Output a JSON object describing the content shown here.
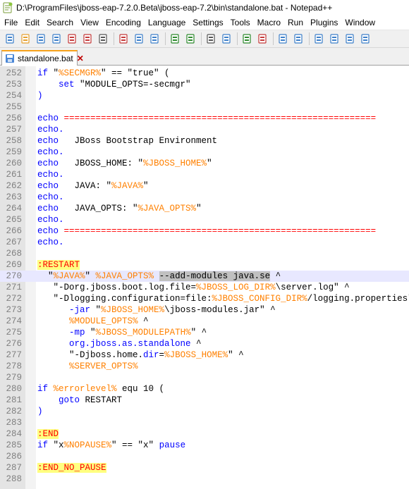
{
  "window": {
    "title": "D:\\ProgramFiles\\jboss-eap-7.2.0.Beta\\jboss-eap-7.2\\bin\\standalone.bat - Notepad++"
  },
  "menu": [
    "File",
    "Edit",
    "Search",
    "View",
    "Encoding",
    "Language",
    "Settings",
    "Tools",
    "Macro",
    "Run",
    "Plugins",
    "Window"
  ],
  "toolbar_icons": [
    "new-icon",
    "open-icon",
    "save-icon",
    "save-all-icon",
    "close-icon",
    "close-all-icon",
    "print-icon",
    "cut-icon",
    "copy-icon",
    "paste-icon",
    "undo-icon",
    "redo-icon",
    "find-icon",
    "replace-icon",
    "zoom-in-icon",
    "zoom-out-icon",
    "sync-vertical-icon",
    "sync-horizontal-icon",
    "word-wrap-icon",
    "show-all-chars-icon",
    "indent-guide-icon",
    "doc-map-icon"
  ],
  "tab": {
    "label": "standalone.bat",
    "close": "✕"
  },
  "editor": {
    "current_line": 270,
    "lines": [
      {
        "n": "252",
        "tokens": [
          [
            "kw",
            "if"
          ],
          [
            "plain",
            " \""
          ],
          [
            "var",
            "%SECMGR%"
          ],
          [
            "plain",
            "\" == \"true\" ("
          ]
        ]
      },
      {
        "n": "253",
        "tokens": [
          [
            "plain",
            "    "
          ],
          [
            "kw",
            "set"
          ],
          [
            "plain",
            " \"MODULE_OPTS=-secmgr\""
          ]
        ]
      },
      {
        "n": "254",
        "tokens": [
          [
            "kw",
            ")"
          ]
        ]
      },
      {
        "n": "255",
        "tokens": []
      },
      {
        "n": "256",
        "tokens": [
          [
            "kw",
            "echo"
          ],
          [
            "plain",
            " "
          ],
          [
            "lbl2",
            "==========================================================="
          ]
        ]
      },
      {
        "n": "257",
        "tokens": [
          [
            "kw",
            "echo."
          ]
        ]
      },
      {
        "n": "258",
        "tokens": [
          [
            "kw",
            "echo"
          ],
          [
            "plain",
            "   JBoss Bootstrap Environment"
          ]
        ]
      },
      {
        "n": "259",
        "tokens": [
          [
            "kw",
            "echo."
          ]
        ]
      },
      {
        "n": "260",
        "tokens": [
          [
            "kw",
            "echo"
          ],
          [
            "plain",
            "   JBOSS_HOME: \""
          ],
          [
            "var",
            "%JBOSS_HOME%"
          ],
          [
            "plain",
            "\""
          ]
        ]
      },
      {
        "n": "261",
        "tokens": [
          [
            "kw",
            "echo."
          ]
        ]
      },
      {
        "n": "262",
        "tokens": [
          [
            "kw",
            "echo"
          ],
          [
            "plain",
            "   JAVA: \""
          ],
          [
            "var",
            "%JAVA%"
          ],
          [
            "plain",
            "\""
          ]
        ]
      },
      {
        "n": "263",
        "tokens": [
          [
            "kw",
            "echo."
          ]
        ]
      },
      {
        "n": "264",
        "tokens": [
          [
            "kw",
            "echo"
          ],
          [
            "plain",
            "   JAVA_OPTS: \""
          ],
          [
            "var",
            "%JAVA_OPTS%"
          ],
          [
            "plain",
            "\""
          ]
        ]
      },
      {
        "n": "265",
        "tokens": [
          [
            "kw",
            "echo."
          ]
        ]
      },
      {
        "n": "266",
        "tokens": [
          [
            "kw",
            "echo"
          ],
          [
            "plain",
            " "
          ],
          [
            "lbl2",
            "==========================================================="
          ]
        ]
      },
      {
        "n": "267",
        "tokens": [
          [
            "kw",
            "echo."
          ]
        ]
      },
      {
        "n": "268",
        "tokens": []
      },
      {
        "n": "269",
        "tokens": [
          [
            "lbl",
            ":RESTART"
          ]
        ]
      },
      {
        "n": "270",
        "tokens": [
          [
            "plain",
            "  \""
          ],
          [
            "var",
            "%JAVA%"
          ],
          [
            "plain",
            "\" "
          ],
          [
            "var",
            "%JAVA_OPTS%"
          ],
          [
            "plain",
            " "
          ],
          [
            "sel",
            "--add-modules java.se"
          ],
          [
            "plain",
            " ^"
          ]
        ]
      },
      {
        "n": "271",
        "tokens": [
          [
            "plain",
            "   \"-Dorg.jboss.boot.log.file="
          ],
          [
            "var",
            "%JBOSS_LOG_DIR%"
          ],
          [
            "plain",
            "\\server.log\" ^"
          ]
        ]
      },
      {
        "n": "272",
        "tokens": [
          [
            "plain",
            "   \"-Dlogging.configuration=file:"
          ],
          [
            "var",
            "%JBOSS_CONFIG_DIR%"
          ],
          [
            "plain",
            "/logging.properties\" ^"
          ]
        ]
      },
      {
        "n": "273",
        "tokens": [
          [
            "plain",
            "      "
          ],
          [
            "kw",
            "-jar"
          ],
          [
            "plain",
            " \""
          ],
          [
            "var",
            "%JBOSS_HOME%"
          ],
          [
            "plain",
            "\\jboss-modules.jar\" ^"
          ]
        ]
      },
      {
        "n": "274",
        "tokens": [
          [
            "plain",
            "      "
          ],
          [
            "var",
            "%MODULE_OPTS%"
          ],
          [
            "plain",
            " ^"
          ]
        ]
      },
      {
        "n": "275",
        "tokens": [
          [
            "plain",
            "      "
          ],
          [
            "kw",
            "-mp"
          ],
          [
            "plain",
            " \""
          ],
          [
            "var",
            "%JBOSS_MODULEPATH%"
          ],
          [
            "plain",
            "\" ^"
          ]
        ]
      },
      {
        "n": "276",
        "tokens": [
          [
            "plain",
            "      "
          ],
          [
            "kw",
            "org.jboss.as.standalone"
          ],
          [
            "plain",
            " ^"
          ]
        ]
      },
      {
        "n": "277",
        "tokens": [
          [
            "plain",
            "      \"-Djboss.home."
          ],
          [
            "kw",
            "dir"
          ],
          [
            "plain",
            "="
          ],
          [
            "var",
            "%JBOSS_HOME%"
          ],
          [
            "plain",
            "\" ^"
          ]
        ]
      },
      {
        "n": "278",
        "tokens": [
          [
            "plain",
            "      "
          ],
          [
            "var",
            "%SERVER_OPTS%"
          ]
        ]
      },
      {
        "n": "279",
        "tokens": []
      },
      {
        "n": "280",
        "tokens": [
          [
            "kw",
            "if"
          ],
          [
            "plain",
            " "
          ],
          [
            "var",
            "%errorlevel%"
          ],
          [
            "plain",
            " equ 10 ("
          ]
        ]
      },
      {
        "n": "281",
        "tokens": [
          [
            "plain",
            "    "
          ],
          [
            "kw",
            "goto"
          ],
          [
            "plain",
            " RESTART"
          ]
        ]
      },
      {
        "n": "282",
        "tokens": [
          [
            "kw",
            ")"
          ]
        ]
      },
      {
        "n": "283",
        "tokens": []
      },
      {
        "n": "284",
        "tokens": [
          [
            "lbl",
            ":END"
          ]
        ]
      },
      {
        "n": "285",
        "tokens": [
          [
            "kw",
            "if"
          ],
          [
            "plain",
            " \"x"
          ],
          [
            "var",
            "%NOPAUSE%"
          ],
          [
            "plain",
            "\" == \"x\" "
          ],
          [
            "kw",
            "pause"
          ]
        ]
      },
      {
        "n": "286",
        "tokens": []
      },
      {
        "n": "287",
        "tokens": [
          [
            "lbl",
            ":END_NO_PAUSE"
          ]
        ]
      },
      {
        "n": "288",
        "tokens": []
      }
    ]
  }
}
